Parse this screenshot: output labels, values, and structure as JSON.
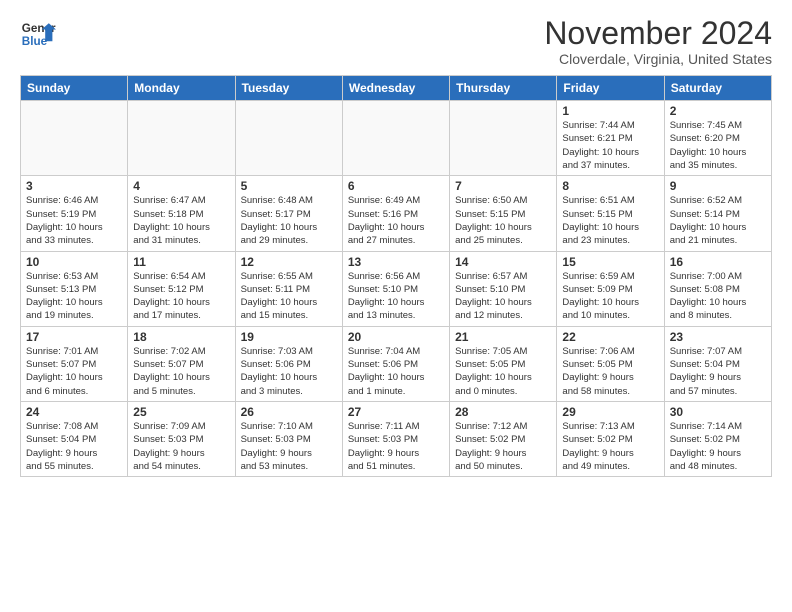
{
  "logo": {
    "line1": "General",
    "line2": "Blue"
  },
  "title": "November 2024",
  "subtitle": "Cloverdale, Virginia, United States",
  "days_of_week": [
    "Sunday",
    "Monday",
    "Tuesday",
    "Wednesday",
    "Thursday",
    "Friday",
    "Saturday"
  ],
  "weeks": [
    [
      {
        "day": "",
        "info": ""
      },
      {
        "day": "",
        "info": ""
      },
      {
        "day": "",
        "info": ""
      },
      {
        "day": "",
        "info": ""
      },
      {
        "day": "",
        "info": ""
      },
      {
        "day": "1",
        "info": "Sunrise: 7:44 AM\nSunset: 6:21 PM\nDaylight: 10 hours\nand 37 minutes."
      },
      {
        "day": "2",
        "info": "Sunrise: 7:45 AM\nSunset: 6:20 PM\nDaylight: 10 hours\nand 35 minutes."
      }
    ],
    [
      {
        "day": "3",
        "info": "Sunrise: 6:46 AM\nSunset: 5:19 PM\nDaylight: 10 hours\nand 33 minutes."
      },
      {
        "day": "4",
        "info": "Sunrise: 6:47 AM\nSunset: 5:18 PM\nDaylight: 10 hours\nand 31 minutes."
      },
      {
        "day": "5",
        "info": "Sunrise: 6:48 AM\nSunset: 5:17 PM\nDaylight: 10 hours\nand 29 minutes."
      },
      {
        "day": "6",
        "info": "Sunrise: 6:49 AM\nSunset: 5:16 PM\nDaylight: 10 hours\nand 27 minutes."
      },
      {
        "day": "7",
        "info": "Sunrise: 6:50 AM\nSunset: 5:15 PM\nDaylight: 10 hours\nand 25 minutes."
      },
      {
        "day": "8",
        "info": "Sunrise: 6:51 AM\nSunset: 5:15 PM\nDaylight: 10 hours\nand 23 minutes."
      },
      {
        "day": "9",
        "info": "Sunrise: 6:52 AM\nSunset: 5:14 PM\nDaylight: 10 hours\nand 21 minutes."
      }
    ],
    [
      {
        "day": "10",
        "info": "Sunrise: 6:53 AM\nSunset: 5:13 PM\nDaylight: 10 hours\nand 19 minutes."
      },
      {
        "day": "11",
        "info": "Sunrise: 6:54 AM\nSunset: 5:12 PM\nDaylight: 10 hours\nand 17 minutes."
      },
      {
        "day": "12",
        "info": "Sunrise: 6:55 AM\nSunset: 5:11 PM\nDaylight: 10 hours\nand 15 minutes."
      },
      {
        "day": "13",
        "info": "Sunrise: 6:56 AM\nSunset: 5:10 PM\nDaylight: 10 hours\nand 13 minutes."
      },
      {
        "day": "14",
        "info": "Sunrise: 6:57 AM\nSunset: 5:10 PM\nDaylight: 10 hours\nand 12 minutes."
      },
      {
        "day": "15",
        "info": "Sunrise: 6:59 AM\nSunset: 5:09 PM\nDaylight: 10 hours\nand 10 minutes."
      },
      {
        "day": "16",
        "info": "Sunrise: 7:00 AM\nSunset: 5:08 PM\nDaylight: 10 hours\nand 8 minutes."
      }
    ],
    [
      {
        "day": "17",
        "info": "Sunrise: 7:01 AM\nSunset: 5:07 PM\nDaylight: 10 hours\nand 6 minutes."
      },
      {
        "day": "18",
        "info": "Sunrise: 7:02 AM\nSunset: 5:07 PM\nDaylight: 10 hours\nand 5 minutes."
      },
      {
        "day": "19",
        "info": "Sunrise: 7:03 AM\nSunset: 5:06 PM\nDaylight: 10 hours\nand 3 minutes."
      },
      {
        "day": "20",
        "info": "Sunrise: 7:04 AM\nSunset: 5:06 PM\nDaylight: 10 hours\nand 1 minute."
      },
      {
        "day": "21",
        "info": "Sunrise: 7:05 AM\nSunset: 5:05 PM\nDaylight: 10 hours\nand 0 minutes."
      },
      {
        "day": "22",
        "info": "Sunrise: 7:06 AM\nSunset: 5:05 PM\nDaylight: 9 hours\nand 58 minutes."
      },
      {
        "day": "23",
        "info": "Sunrise: 7:07 AM\nSunset: 5:04 PM\nDaylight: 9 hours\nand 57 minutes."
      }
    ],
    [
      {
        "day": "24",
        "info": "Sunrise: 7:08 AM\nSunset: 5:04 PM\nDaylight: 9 hours\nand 55 minutes."
      },
      {
        "day": "25",
        "info": "Sunrise: 7:09 AM\nSunset: 5:03 PM\nDaylight: 9 hours\nand 54 minutes."
      },
      {
        "day": "26",
        "info": "Sunrise: 7:10 AM\nSunset: 5:03 PM\nDaylight: 9 hours\nand 53 minutes."
      },
      {
        "day": "27",
        "info": "Sunrise: 7:11 AM\nSunset: 5:03 PM\nDaylight: 9 hours\nand 51 minutes."
      },
      {
        "day": "28",
        "info": "Sunrise: 7:12 AM\nSunset: 5:02 PM\nDaylight: 9 hours\nand 50 minutes."
      },
      {
        "day": "29",
        "info": "Sunrise: 7:13 AM\nSunset: 5:02 PM\nDaylight: 9 hours\nand 49 minutes."
      },
      {
        "day": "30",
        "info": "Sunrise: 7:14 AM\nSunset: 5:02 PM\nDaylight: 9 hours\nand 48 minutes."
      }
    ]
  ]
}
